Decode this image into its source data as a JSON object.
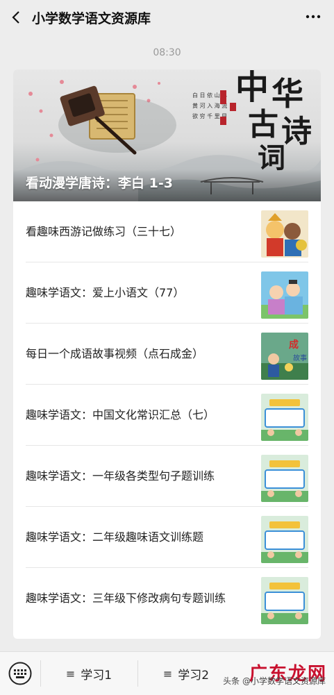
{
  "header": {
    "title": "小学数学语文资源库",
    "back_icon": "chevron-left-icon",
    "more_icon": "more-icon"
  },
  "timestamp": "08:30",
  "banner": {
    "title": "看动漫学唐诗：李白 1-3",
    "calligraphy": [
      "中",
      "华",
      "古",
      "诗",
      "词"
    ],
    "colors": {
      "sky": "#e2e2e2",
      "water": "#9ca3a5",
      "blossom": "#e58a97"
    }
  },
  "articles": [
    {
      "title": "看趣味西游记做练习（三十七）",
      "thumb": "journey-west-cartoon"
    },
    {
      "title": "趣味学语文：爱上小语文（77）",
      "thumb": "ancient-scholar-cartoon"
    },
    {
      "title": "每日一个成语故事视频（点石成金）",
      "thumb": "idiom-story-cartoon",
      "thumb_text": "成语故事"
    },
    {
      "title": "趣味学语文：中国文化常识汇总（七）",
      "thumb": "fun-chinese-poster"
    },
    {
      "title": "趣味学语文：一年级各类型句子题训练",
      "thumb": "fun-chinese-poster"
    },
    {
      "title": "趣味学语文：二年级趣味语文训练题",
      "thumb": "fun-chinese-poster"
    },
    {
      "title": "趣味学语文：三年级下修改病句专题训练",
      "thumb": "fun-chinese-poster"
    }
  ],
  "bottom_menu": {
    "keyboard_icon": "keyboard-icon",
    "items": [
      {
        "label": "学习1",
        "icon": "menu-icon"
      },
      {
        "label": "学习2",
        "icon": "menu-icon"
      }
    ]
  },
  "watermark": {
    "logo": "广东龙网",
    "credit": "头条 @小学数学语文资源库"
  }
}
